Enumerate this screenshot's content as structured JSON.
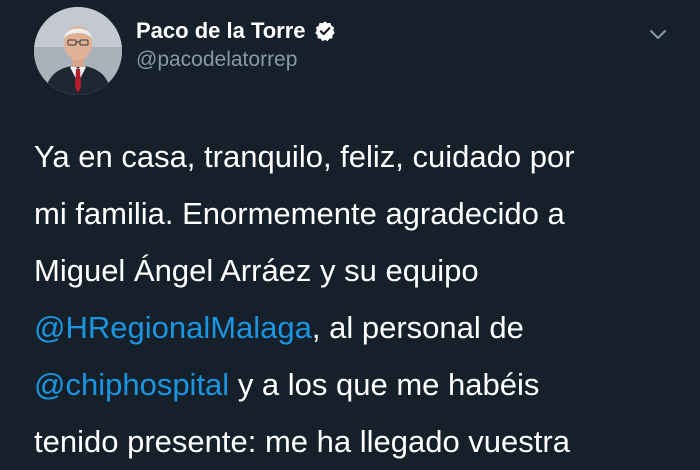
{
  "author": {
    "display_name": "Paco de la Torre",
    "handle": "@pacodelatorrep",
    "verified": true
  },
  "icons": {
    "verified": "verified-badge-icon",
    "menu": "chevron-down-icon"
  },
  "colors": {
    "background": "#15202b",
    "text": "#ffffff",
    "secondary": "#8899a6",
    "link": "#1b95e0"
  },
  "tweet": {
    "line1": "Ya en casa, tranquilo, feliz, cuidado por",
    "line2": "mi familia. Enormemente agradecido a",
    "line3": "Miguel Ángel Arráez y su equipo",
    "line4_mention": "@HRegionalMalaga",
    "line4_rest": ", al personal de",
    "line5_mention": "@chiphospital",
    "line5_rest": " y a los que me habéis",
    "line6": "tenido presente: me ha llegado vuestra"
  }
}
